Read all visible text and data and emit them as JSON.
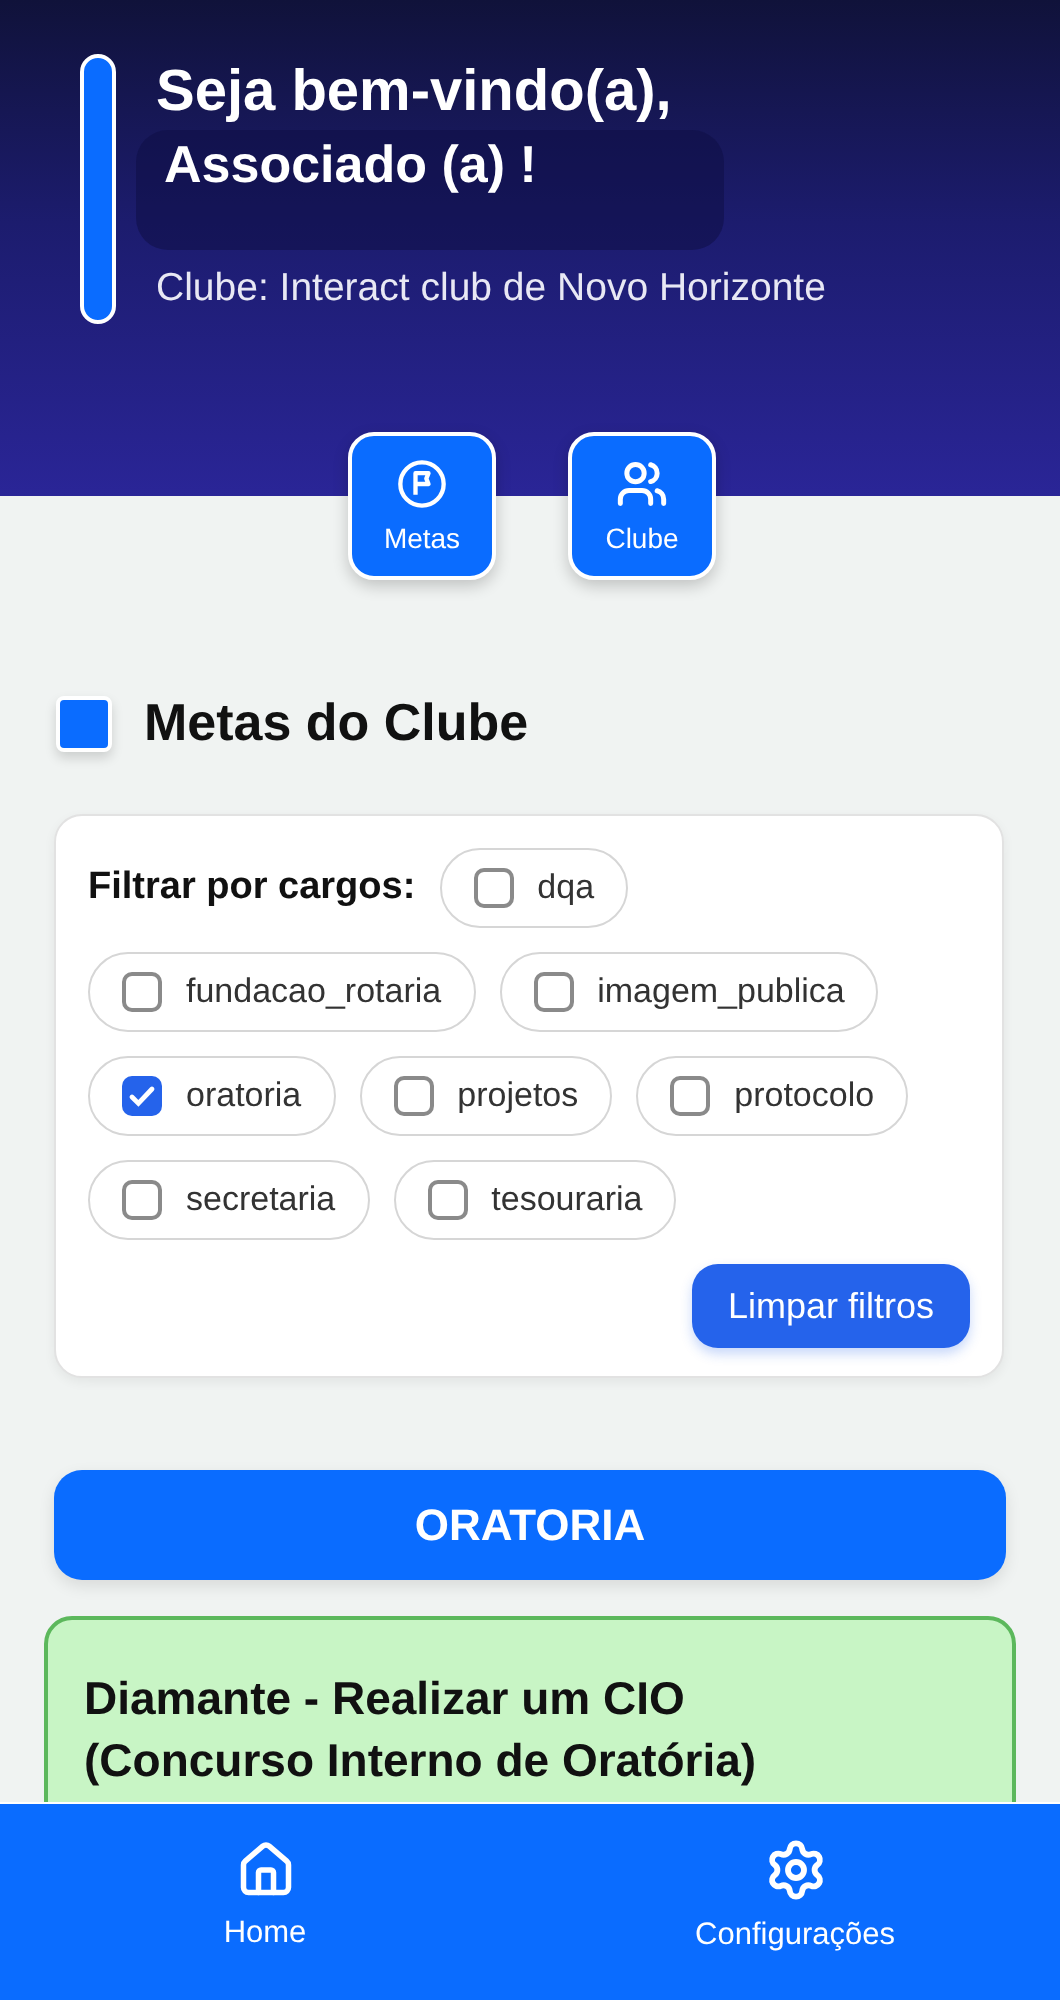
{
  "header": {
    "greeting": "Seja bem-vindo(a),",
    "user": "Associado (a) !",
    "club": "Clube: Interact club de Novo Horizonte"
  },
  "quick_actions": [
    {
      "label": "Metas"
    },
    {
      "label": "Clube"
    }
  ],
  "section": {
    "title": "Metas do Clube"
  },
  "filter": {
    "label": "Filtrar por cargos:",
    "clear_button": "Limpar filtros",
    "options": [
      {
        "label": "dqa",
        "checked": false
      },
      {
        "label": "fundacao_rotaria",
        "checked": false
      },
      {
        "label": "imagem_publica",
        "checked": false
      },
      {
        "label": "oratoria",
        "checked": true
      },
      {
        "label": "projetos",
        "checked": false
      },
      {
        "label": "protocolo",
        "checked": false
      },
      {
        "label": "secretaria",
        "checked": false
      },
      {
        "label": "tesouraria",
        "checked": false
      }
    ]
  },
  "category": "ORATORIA",
  "goals": [
    {
      "title": "Diamante - Realizar um CIO (Concurso Interno de Oratória)"
    }
  ],
  "bottom_nav": [
    {
      "label": "Home"
    },
    {
      "label": "Configurações"
    }
  ]
}
